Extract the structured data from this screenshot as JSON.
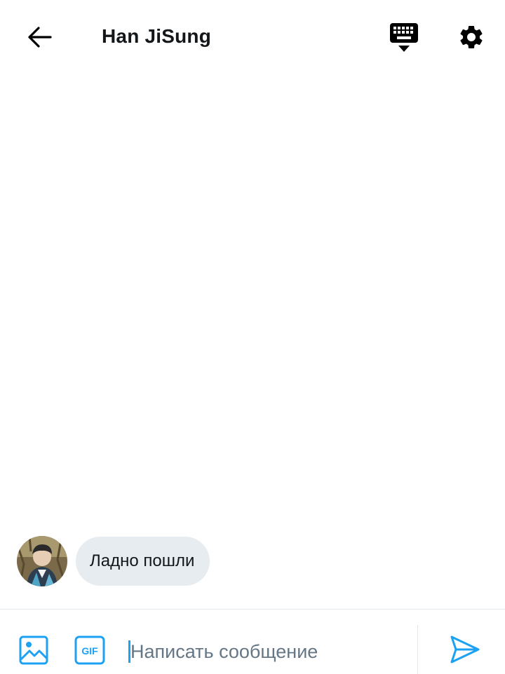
{
  "header": {
    "title": "Han JiSung",
    "back_icon": "arrow-left-icon",
    "keyboard_icon": "keyboard-hide-icon",
    "settings_icon": "gear-icon"
  },
  "messages": [
    {
      "sender": "Han JiSung",
      "text": "Ладно пошли",
      "avatar_icon": "avatar"
    }
  ],
  "composer": {
    "placeholder": "Написать сообщение",
    "value": "",
    "image_icon": "image-icon",
    "gif_icon": "gif-icon",
    "gif_label": "GIF",
    "send_icon": "send-icon"
  },
  "colors": {
    "accent": "#1da1f2",
    "bubble": "#e6ecf0",
    "text": "#14171a",
    "placeholder": "#657786",
    "divider": "#e1e8ed"
  }
}
